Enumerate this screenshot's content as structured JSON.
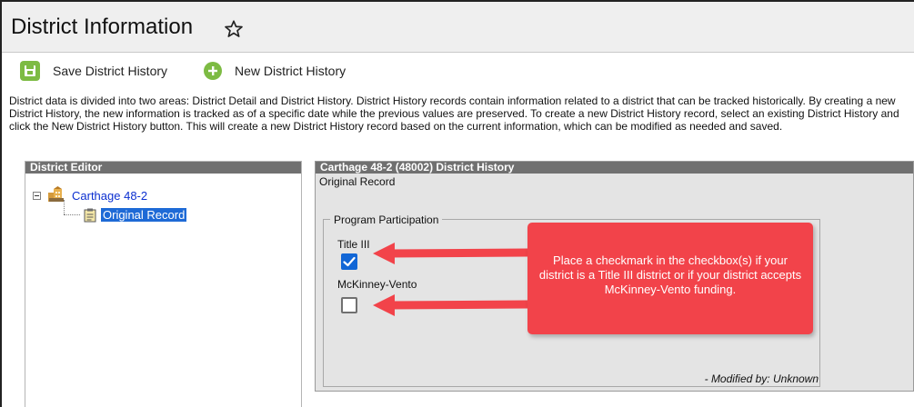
{
  "header": {
    "title": "District Information",
    "star_icon": "star-outline-icon"
  },
  "toolbar": {
    "save_label": "Save District History",
    "save_icon": "save-icon",
    "new_label": "New District History",
    "new_icon": "plus-circle-icon",
    "icon_color": "#7dbb43"
  },
  "description": "District data is divided into two areas: District Detail and District History. District History records contain information related to a district that can be tracked historically. By creating a new District History, the new information is tracked as of a specific date while the previous values are preserved. To create a new District History record, select an existing District History and click the New District History button. This will create a new District History record based on the current information, which can be modified as needed and saved.",
  "editor": {
    "header": "District Editor",
    "tree": {
      "district": "Carthage 48-2",
      "district_icon": "district-building-icon",
      "record": "Original Record",
      "record_icon": "clipboard-icon"
    }
  },
  "history": {
    "header": "Carthage 48-2 (48002) District History",
    "record_label": "Original Record",
    "program_participation": {
      "legend": "Program Participation",
      "title_iii": {
        "label": "Title III",
        "checked": true
      },
      "mckinney_vento": {
        "label": "McKinney-Vento",
        "checked": false
      }
    },
    "modified_by": "- Modified by: Unknown"
  },
  "callout": {
    "text": "Place a checkmark in the checkbox(s) if your district is a Title III district or if your district accepts McKinney-Vento funding.",
    "color": "#f2434a"
  },
  "colors": {
    "panel_header": "#707070",
    "panel_bg": "#e4e4e4",
    "selection": "#1e6ad6",
    "link": "#0b2fd0",
    "checkbox_checked": "#1166d6"
  }
}
